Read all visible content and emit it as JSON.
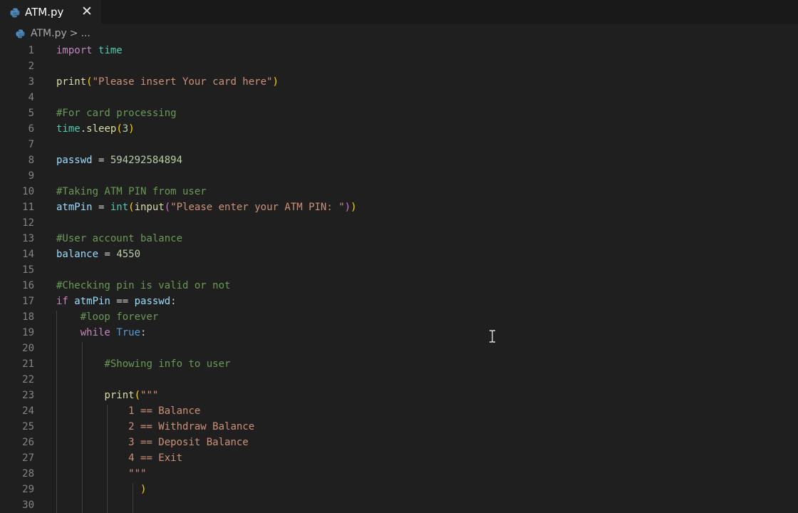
{
  "tab": {
    "filename": "ATM.py",
    "close_glyph": "✕"
  },
  "breadcrumb": {
    "file": "ATM.py",
    "separator": ">",
    "more": "..."
  },
  "line_numbers": [
    "1",
    "2",
    "3",
    "4",
    "5",
    "6",
    "7",
    "8",
    "9",
    "10",
    "11",
    "12",
    "13",
    "14",
    "15",
    "16",
    "17",
    "18",
    "19",
    "20",
    "21",
    "22",
    "23",
    "24",
    "25",
    "26",
    "27",
    "28",
    "29",
    "30"
  ],
  "code": {
    "l1": {
      "kw": "import",
      "mod": "time"
    },
    "l3": {
      "fn": "print",
      "open": "(",
      "str": "\"Please insert Your card here\"",
      "close": ")"
    },
    "l5": {
      "comment": "#For card processing"
    },
    "l6": {
      "mod": "time",
      "dot": ".",
      "fn": "sleep",
      "open": "(",
      "num": "3",
      "close": ")"
    },
    "l8": {
      "var": "passwd",
      "op": " = ",
      "num": "594292584894"
    },
    "l10": {
      "comment": "#Taking ATM PIN from user"
    },
    "l11": {
      "var": "atmPin",
      "op": " = ",
      "fn1": "int",
      "open1": "(",
      "fn2": "input",
      "open2": "(",
      "str": "\"Please enter your ATM PIN: \"",
      "close2": ")",
      "close1": ")"
    },
    "l13": {
      "comment": "#User account balance"
    },
    "l14": {
      "var": "balance",
      "op": " = ",
      "num": "4550"
    },
    "l16": {
      "comment": "#Checking pin is valid or not"
    },
    "l17": {
      "kw": "if",
      "var1": "atmPin",
      "op": " == ",
      "var2": "passwd",
      "colon": ":"
    },
    "l18": {
      "comment": "#loop forever"
    },
    "l19": {
      "kw": "while",
      "const": "True",
      "colon": ":"
    },
    "l21": {
      "comment": "#Showing info to user"
    },
    "l23": {
      "fn": "print",
      "open": "(",
      "str": "\"\"\""
    },
    "l24": {
      "str": "1 == Balance"
    },
    "l25": {
      "str": "2 == Withdraw Balance"
    },
    "l26": {
      "str": "3 == Deposit Balance"
    },
    "l27": {
      "str": "4 == Exit"
    },
    "l28": {
      "str": "\"\"\""
    },
    "l29": {
      "close": ")"
    }
  },
  "colors": {
    "background": "#1f1f1f",
    "keyword": "#c586c0",
    "function": "#dcdcaa",
    "variable": "#9cdcfe",
    "string": "#ce9178",
    "number": "#b5cea8",
    "comment": "#6a9955",
    "bracket": "#ffd700"
  },
  "cursor": {
    "icon": "text-cursor-icon",
    "glyph": "I"
  }
}
